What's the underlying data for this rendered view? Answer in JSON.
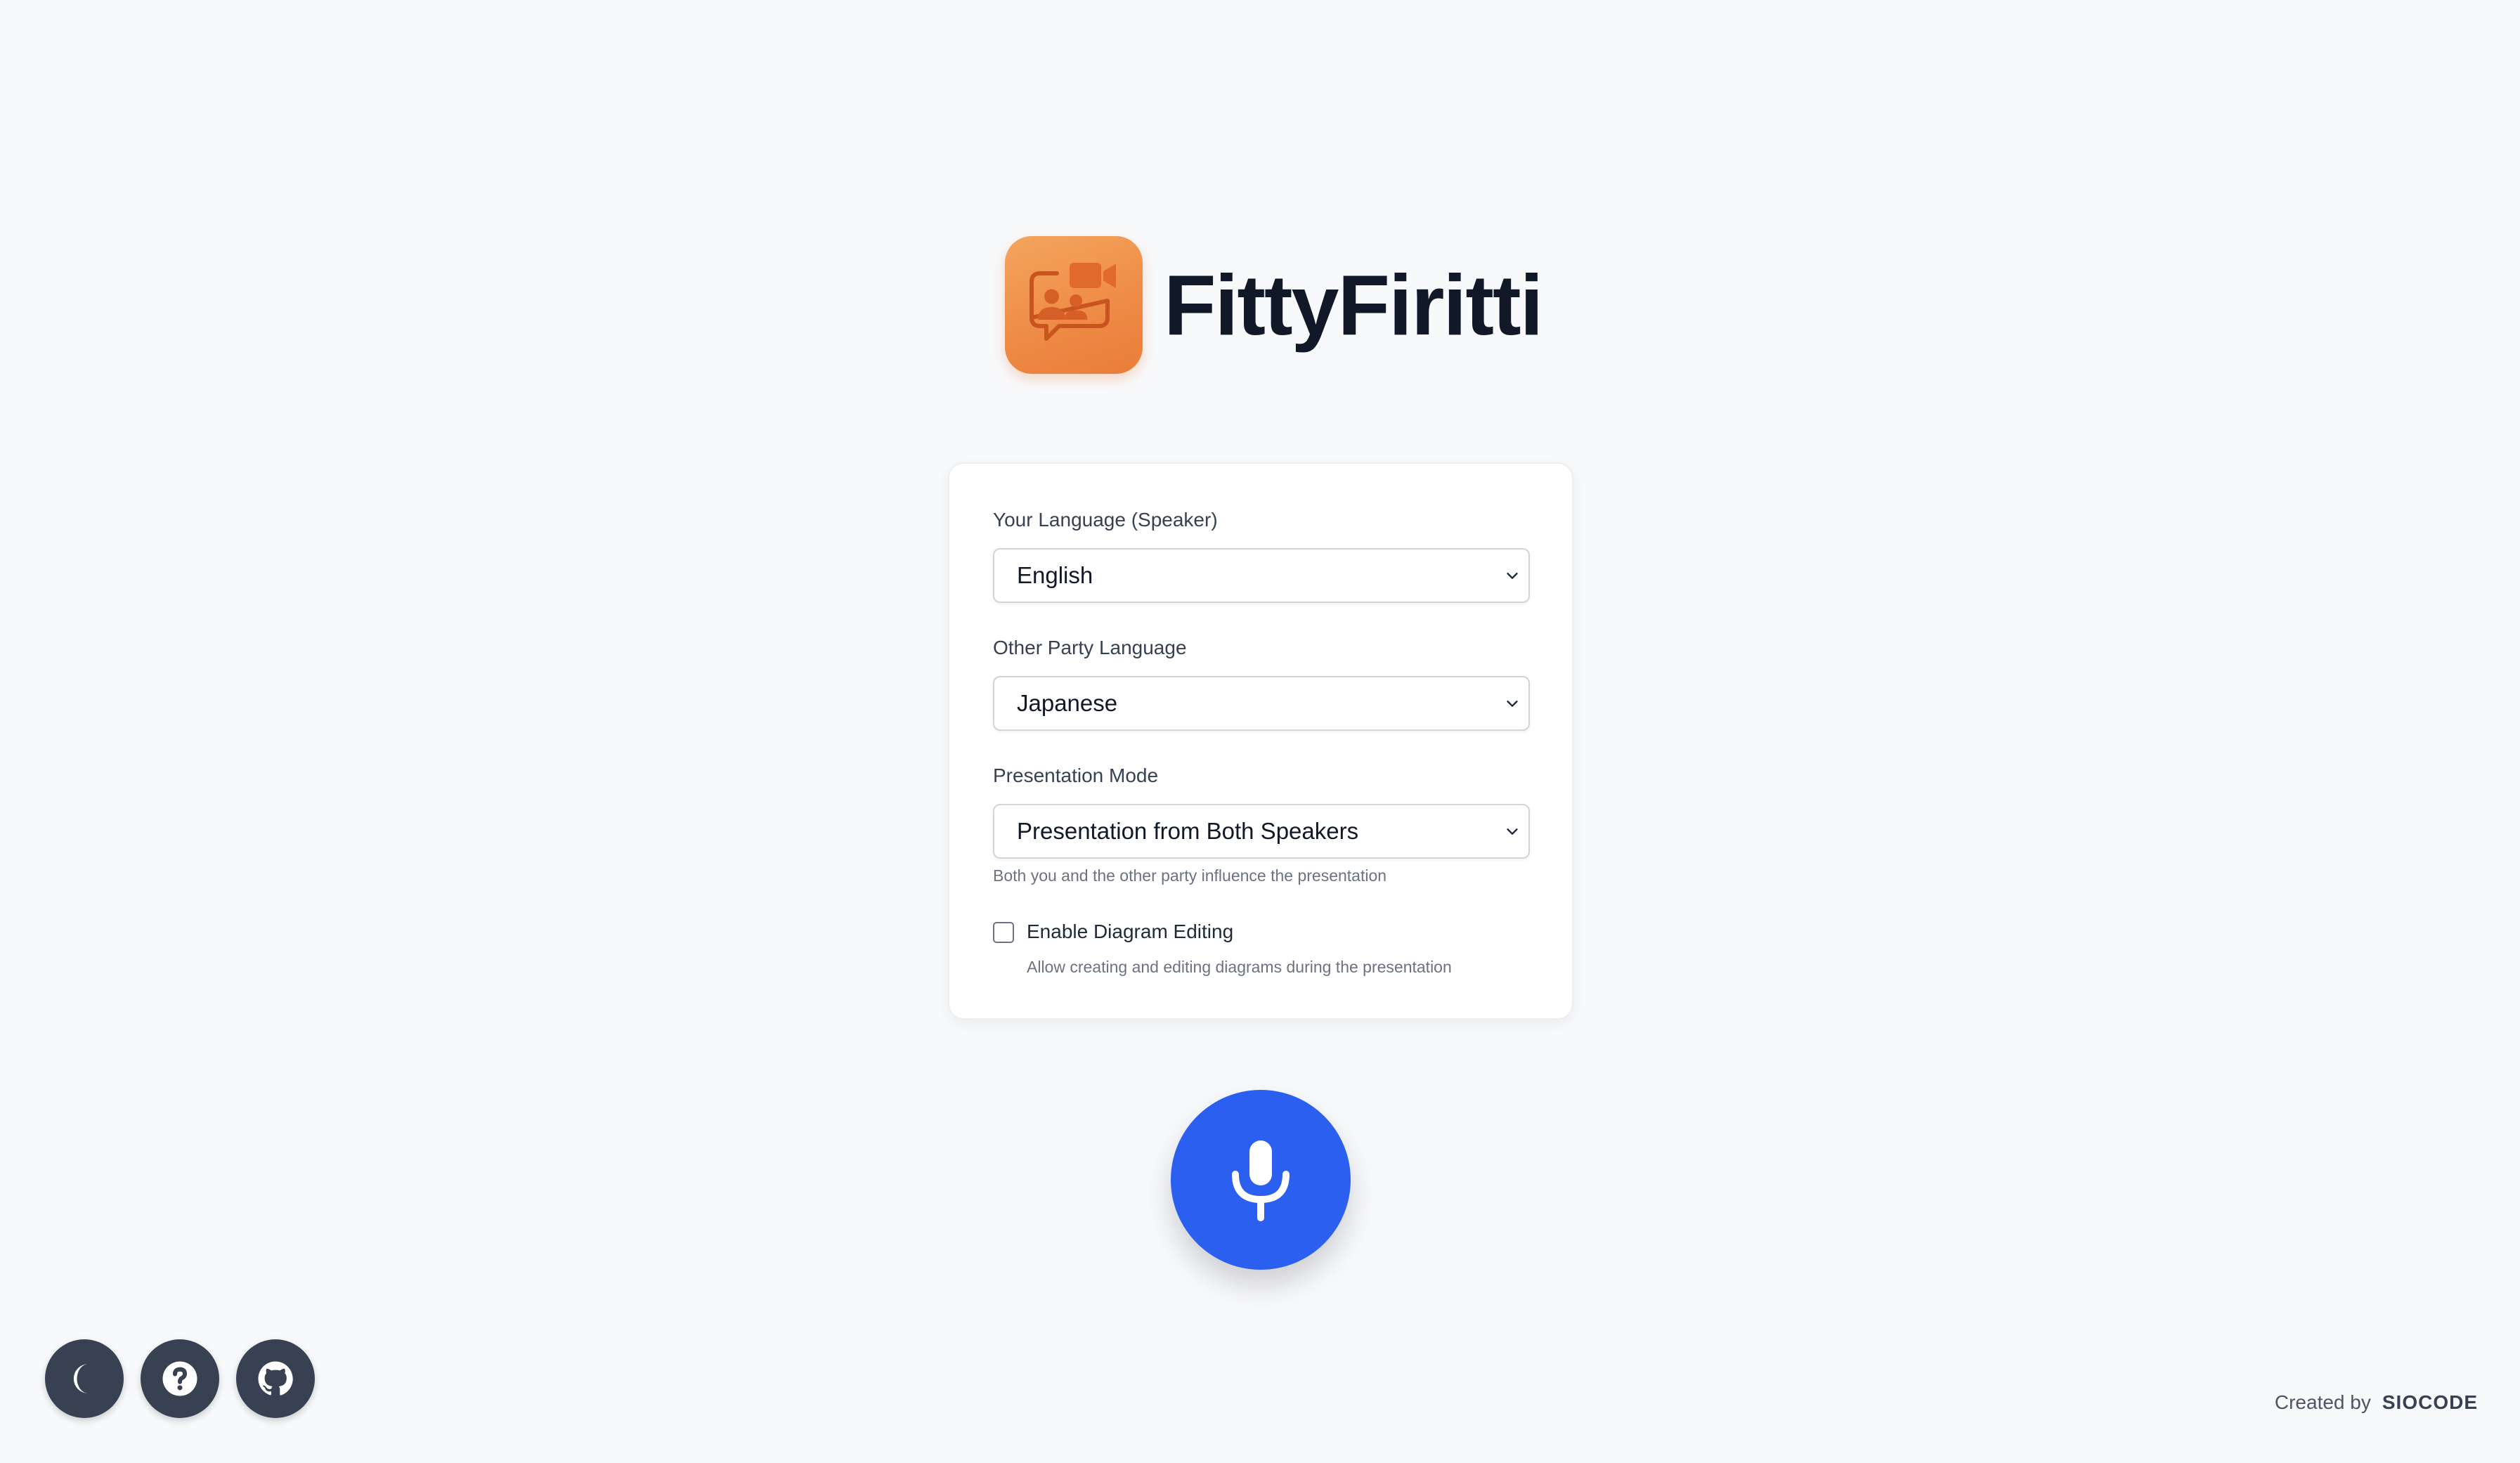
{
  "app": {
    "title": "FittyFiritti",
    "logo_icon": "video-chat-people-icon"
  },
  "form": {
    "speaker_language": {
      "label": "Your Language (Speaker)",
      "selected": "English"
    },
    "other_language": {
      "label": "Other Party Language",
      "selected": "Japanese"
    },
    "presentation_mode": {
      "label": "Presentation Mode",
      "selected": "Presentation from Both Speakers",
      "helper": "Both you and the other party influence the presentation"
    },
    "diagram_editing": {
      "label": "Enable Diagram Editing",
      "helper": "Allow creating and editing diagrams during the presentation",
      "checked": false
    }
  },
  "mic": {
    "icon": "microphone-icon"
  },
  "toolbar": {
    "buttons": [
      {
        "icon": "moon-icon"
      },
      {
        "icon": "help-icon"
      },
      {
        "icon": "github-icon"
      }
    ]
  },
  "footer": {
    "created_by": "Created by",
    "author": "SIOCODE"
  },
  "colors": {
    "accent": "#2b5ff0",
    "logo_orange": "#ee8a45",
    "dark_button": "#374151",
    "background": "#f8f9fb"
  }
}
